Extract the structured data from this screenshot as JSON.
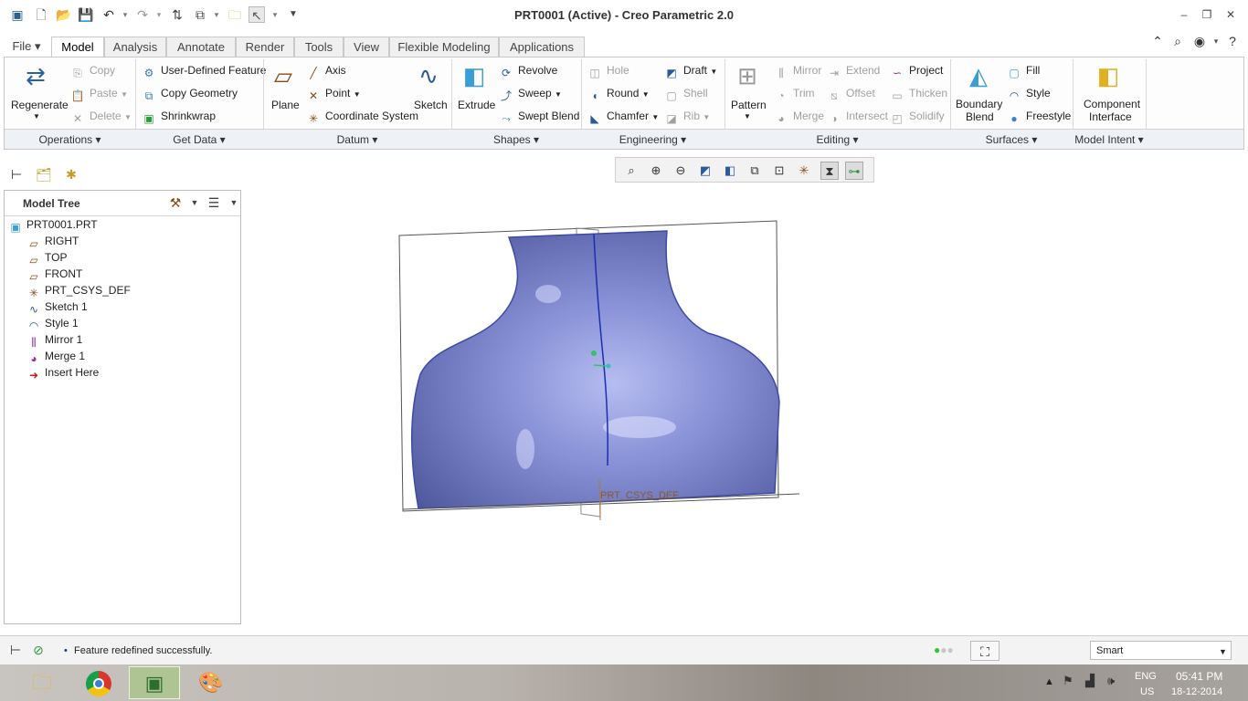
{
  "window": {
    "title": "PRT0001 (Active) - Creo Parametric 2.0"
  },
  "tabs": [
    {
      "label": "File"
    },
    {
      "label": "Model"
    },
    {
      "label": "Analysis"
    },
    {
      "label": "Annotate"
    },
    {
      "label": "Render"
    },
    {
      "label": "Tools"
    },
    {
      "label": "View"
    },
    {
      "label": "Flexible Modeling"
    },
    {
      "label": "Applications"
    }
  ],
  "ribbon": {
    "operations": {
      "regenerate": "Regenerate",
      "copy": "Copy",
      "paste": "Paste",
      "delete": "Delete",
      "group": "Operations"
    },
    "get_data": {
      "udf": "User-Defined Feature",
      "copy_geometry": "Copy Geometry",
      "shrinkwrap": "Shrinkwrap",
      "group": "Get Data"
    },
    "datum": {
      "plane": "Plane",
      "axis": "Axis",
      "point": "Point",
      "csys": "Coordinate System",
      "sketch": "Sketch",
      "group": "Datum"
    },
    "shapes": {
      "extrude": "Extrude",
      "revolve": "Revolve",
      "sweep": "Sweep",
      "swept_blend": "Swept Blend",
      "group": "Shapes"
    },
    "engineering": {
      "hole": "Hole",
      "round": "Round",
      "chamfer": "Chamfer",
      "draft": "Draft",
      "shell": "Shell",
      "rib": "Rib",
      "group": "Engineering"
    },
    "editing": {
      "pattern": "Pattern",
      "mirror": "Mirror",
      "trim": "Trim",
      "merge": "Merge",
      "extend": "Extend",
      "offset": "Offset",
      "intersect": "Intersect",
      "project": "Project",
      "thicken": "Thicken",
      "solidify": "Solidify",
      "group": "Editing"
    },
    "surfaces": {
      "boundary_blend_1": "Boundary",
      "boundary_blend_2": "Blend",
      "fill": "Fill",
      "style": "Style",
      "freestyle": "Freestyle",
      "group": "Surfaces"
    },
    "model_intent": {
      "component_interface_1": "Component",
      "component_interface_2": "Interface",
      "group": "Model Intent"
    }
  },
  "model_tree": {
    "title": "Model Tree",
    "items": [
      {
        "label": "PRT0001.PRT"
      },
      {
        "label": "RIGHT"
      },
      {
        "label": "TOP"
      },
      {
        "label": "FRONT"
      },
      {
        "label": "PRT_CSYS_DEF"
      },
      {
        "label": "Sketch 1"
      },
      {
        "label": "Style 1"
      },
      {
        "label": "Mirror 1"
      },
      {
        "label": "Merge 1"
      },
      {
        "label": "Insert Here"
      }
    ]
  },
  "viewport": {
    "csys_label": "PRT_CSYS_DEF",
    "model_color": "#7d86cf"
  },
  "status": {
    "message": "Feature redefined successfully.",
    "filter": "Smart"
  },
  "taskbar": {
    "lang": "ENG",
    "region": "US",
    "time": "05:41 PM",
    "date": "18-12-2014"
  }
}
